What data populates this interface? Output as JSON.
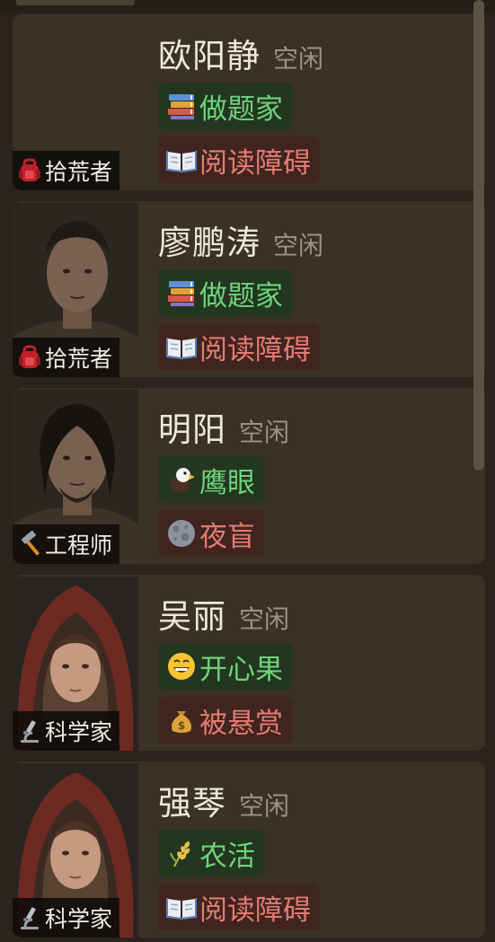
{
  "survivors": [
    {
      "name": "欧阳静",
      "status": "空闲",
      "role": "拾荒者",
      "role_icon": "backpack-icon",
      "portrait": "none",
      "traits": [
        {
          "label": "做题家",
          "icon": "books-icon",
          "kind": "positive"
        },
        {
          "label": "阅读障碍",
          "icon": "open-book-icon",
          "kind": "negative"
        }
      ]
    },
    {
      "name": "廖鹏涛",
      "status": "空闲",
      "role": "拾荒者",
      "role_icon": "backpack-icon",
      "portrait": "male-short-hair",
      "traits": [
        {
          "label": "做题家",
          "icon": "books-icon",
          "kind": "positive"
        },
        {
          "label": "阅读障碍",
          "icon": "open-book-icon",
          "kind": "negative"
        }
      ]
    },
    {
      "name": "明阳",
      "status": "空闲",
      "role": "工程师",
      "role_icon": "hammer-icon",
      "portrait": "male-long-hair",
      "traits": [
        {
          "label": "鹰眼",
          "icon": "eagle-icon",
          "kind": "positive"
        },
        {
          "label": "夜盲",
          "icon": "moon-icon",
          "kind": "negative"
        }
      ]
    },
    {
      "name": "吴丽",
      "status": "空闲",
      "role": "科学家",
      "role_icon": "microscope-icon",
      "portrait": "female-red-hood",
      "traits": [
        {
          "label": "开心果",
          "icon": "grin-face-icon",
          "kind": "positive"
        },
        {
          "label": "被悬赏",
          "icon": "money-bag-icon",
          "kind": "negative"
        }
      ]
    },
    {
      "name": "强琴",
      "status": "空闲",
      "role": "科学家",
      "role_icon": "microscope-icon",
      "portrait": "female-red-hood",
      "traits": [
        {
          "label": "农活",
          "icon": "wheat-icon",
          "kind": "positive"
        },
        {
          "label": "阅读障碍",
          "icon": "open-book-icon",
          "kind": "negative"
        }
      ]
    }
  ],
  "scroll_position": 0.0,
  "colors": {
    "positive_text": "#6ed47a",
    "positive_bg": "#233620",
    "negative_text": "#e47b72",
    "negative_bg": "#40241f"
  }
}
